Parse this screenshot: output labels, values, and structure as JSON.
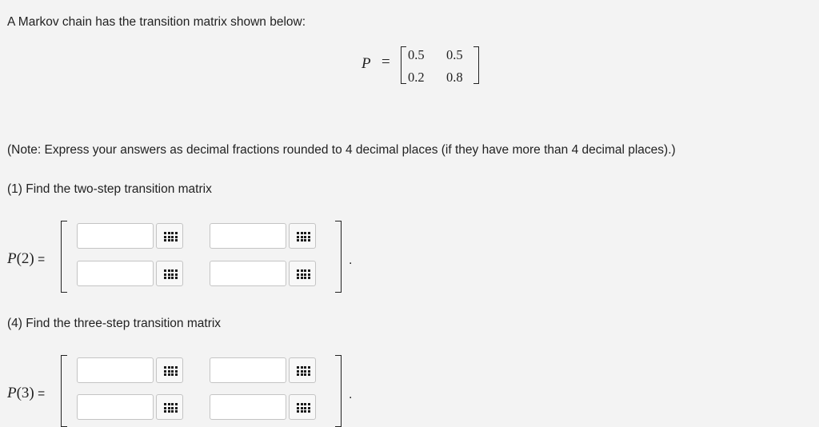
{
  "intro": "A Markov chain has the transition matrix shown below:",
  "given_matrix": {
    "label": "P",
    "equals": "=",
    "rows": [
      [
        "0.5",
        "0.5"
      ],
      [
        "0.2",
        "0.8"
      ]
    ]
  },
  "note": "(Note: Express your answers as decimal fractions rounded to 4 decimal places (if they have more than 4 decimal places).)",
  "question1": {
    "prompt": "(1) Find the two-step transition matrix",
    "label_name": "P",
    "label_arg": "(2)",
    "label_eq": " =",
    "inputs": [
      "",
      "",
      "",
      ""
    ],
    "end_mark": "."
  },
  "question4": {
    "prompt": "(4) Find the three-step transition matrix",
    "label_name": "P",
    "label_arg": "(3)",
    "label_eq": " =",
    "inputs": [
      "",
      "",
      "",
      ""
    ],
    "end_mark": "."
  },
  "icons": {
    "input_tool": "keypad-icon"
  }
}
